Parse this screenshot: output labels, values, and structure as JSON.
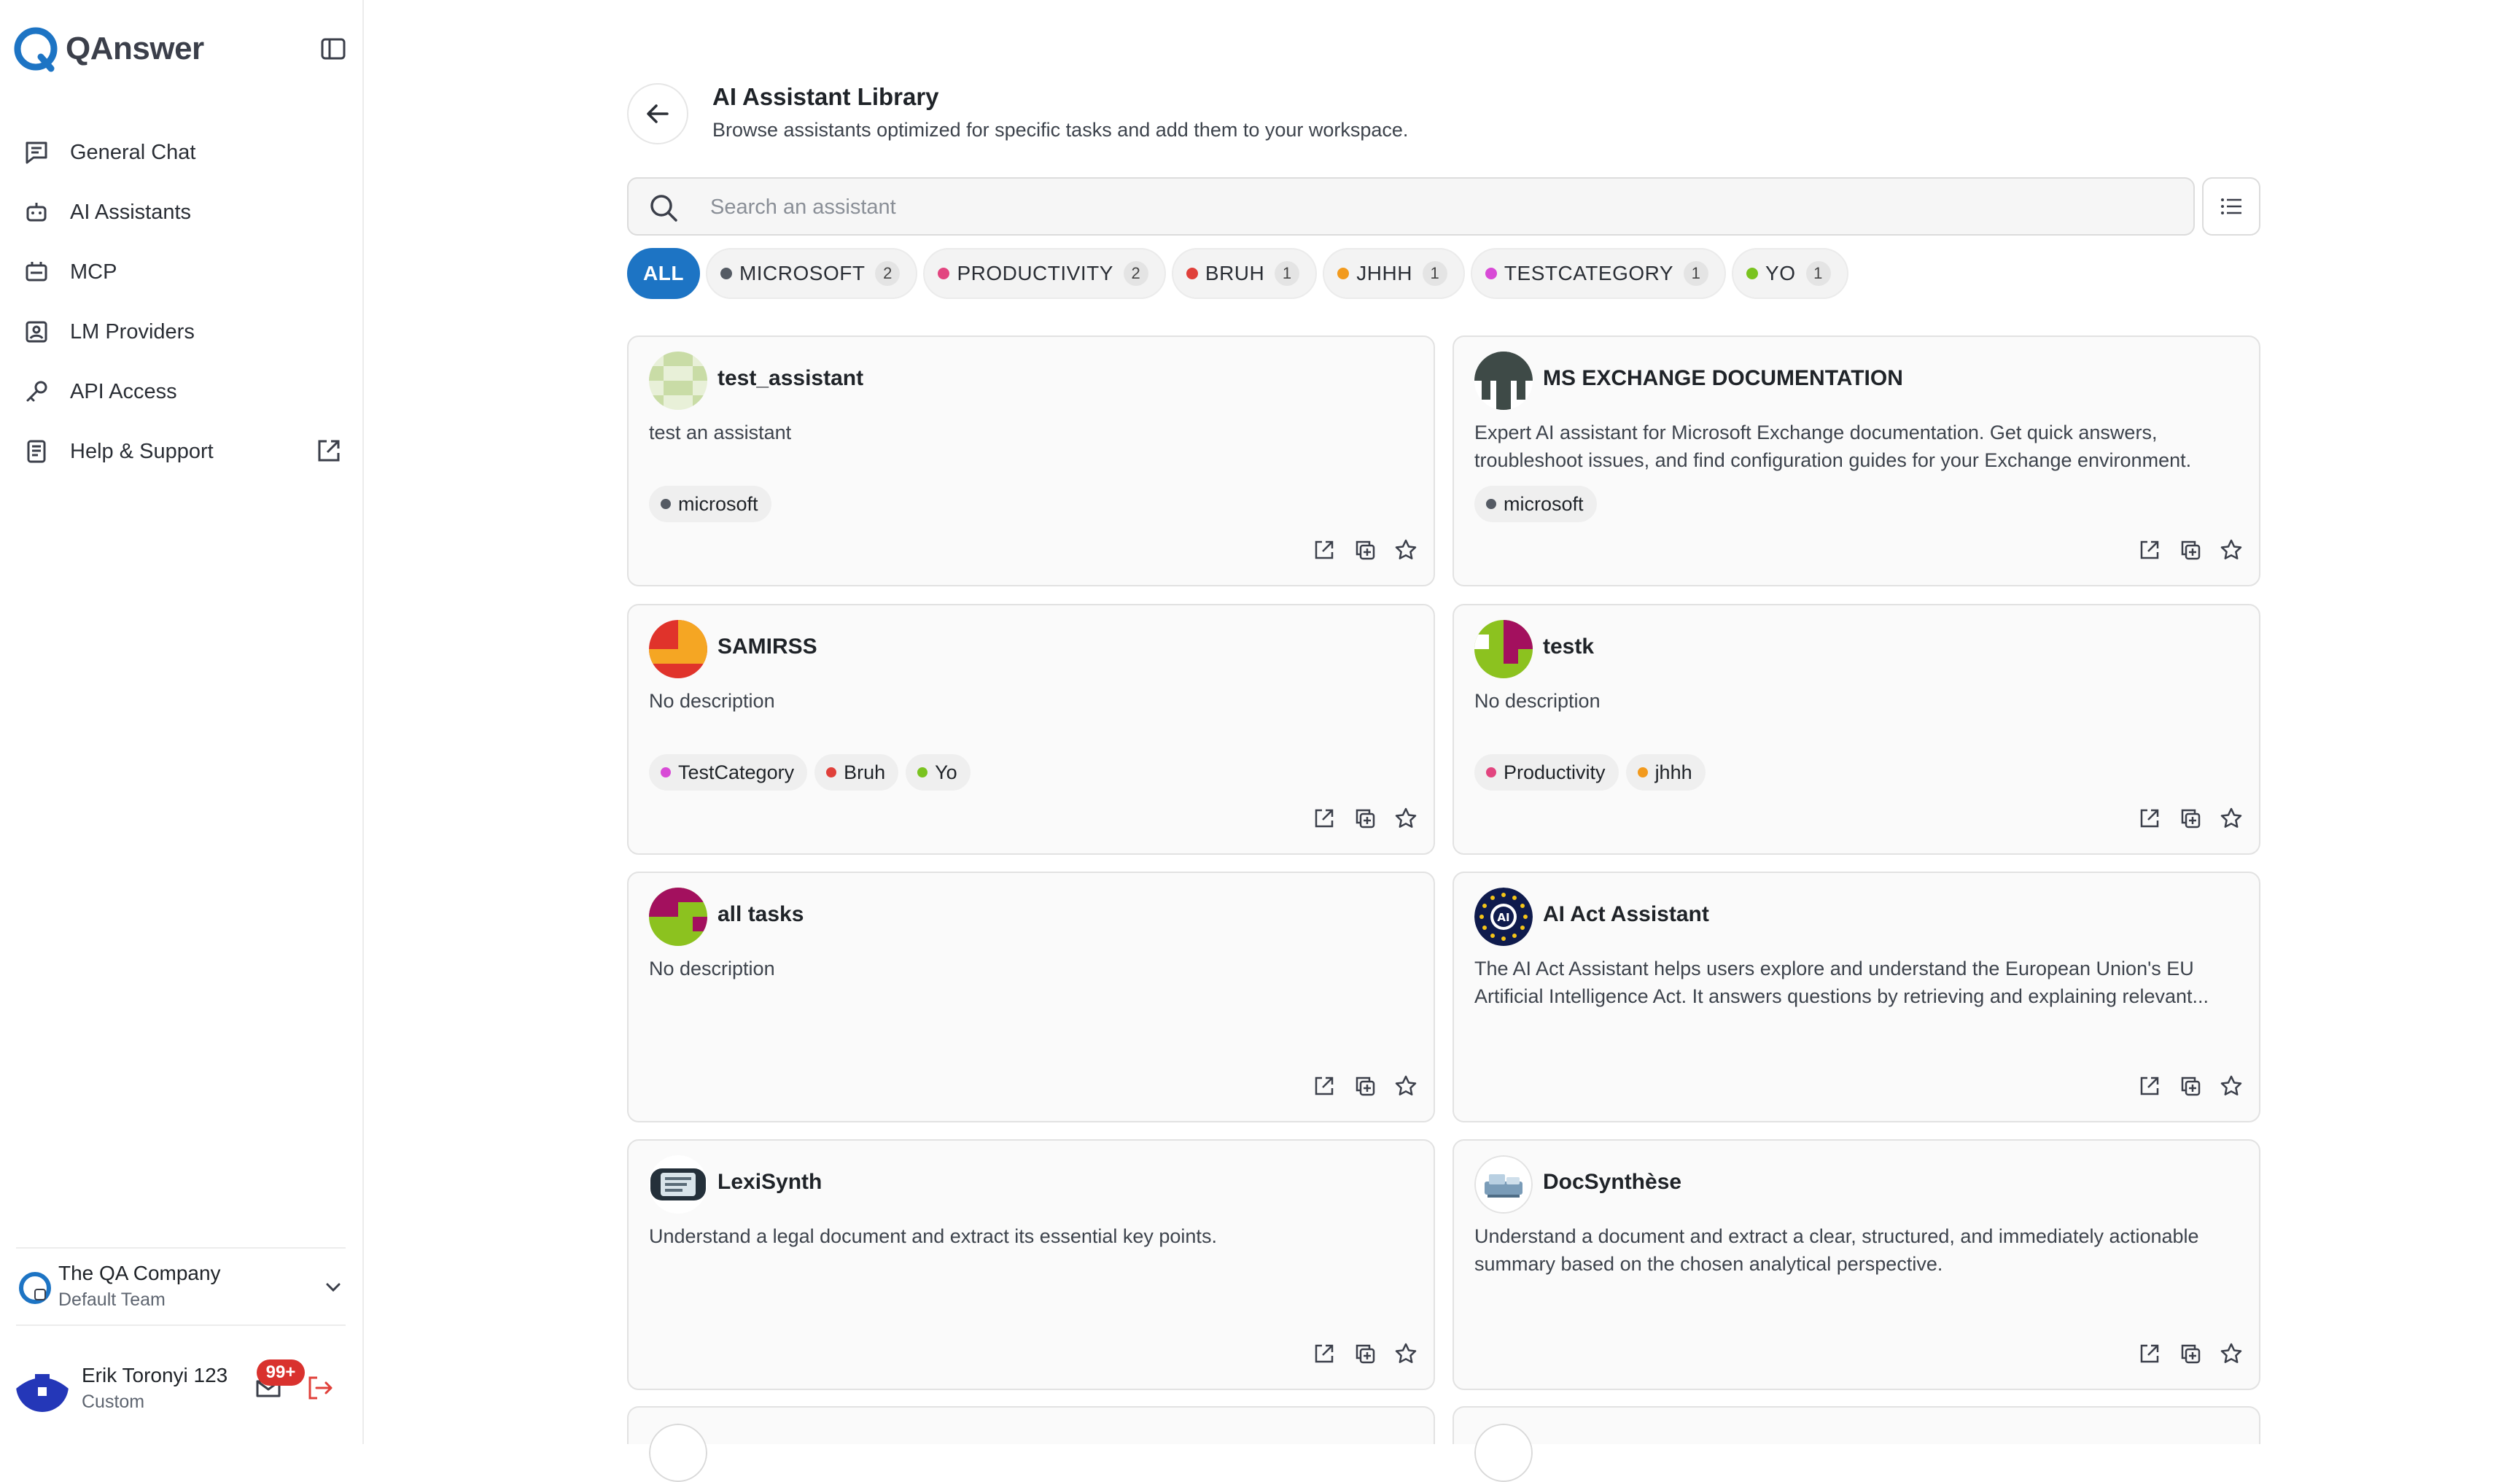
{
  "app": {
    "name": "QAnswer"
  },
  "sidebar": {
    "items": [
      {
        "label": "General Chat",
        "icon": "chat-icon"
      },
      {
        "label": "AI Assistants",
        "icon": "robot-icon"
      },
      {
        "label": "MCP",
        "icon": "mcp-icon"
      },
      {
        "label": "LM Providers",
        "icon": "provider-icon"
      },
      {
        "label": "API Access",
        "icon": "key-icon"
      },
      {
        "label": "Help & Support",
        "icon": "book-icon"
      }
    ],
    "team": {
      "name": "The QA Company",
      "sub": "Default Team"
    },
    "user": {
      "name": "Erik Toronyi 123",
      "role": "Custom",
      "badge": "99+"
    }
  },
  "header": {
    "title": "AI Assistant Library",
    "subtitle": "Browse assistants optimized for specific tasks and add them to your workspace."
  },
  "search": {
    "placeholder": "Search an assistant",
    "value": ""
  },
  "filters": [
    {
      "label": "ALL",
      "active": true
    },
    {
      "label": "MICROSOFT",
      "count": "2",
      "color": "#555b64"
    },
    {
      "label": "PRODUCTIVITY",
      "count": "2",
      "color": "#e2457f"
    },
    {
      "label": "BRUH",
      "count": "1",
      "color": "#e0403a"
    },
    {
      "label": "JHHH",
      "count": "1",
      "color": "#f29a1d"
    },
    {
      "label": "TESTCATEGORY",
      "count": "1",
      "color": "#d84ad6"
    },
    {
      "label": "YO",
      "count": "1",
      "color": "#7ac31f"
    }
  ],
  "assistants": [
    {
      "name": "test_assistant",
      "description": "test an assistant",
      "tags": [
        {
          "label": "microsoft",
          "color": "#555b64"
        }
      ]
    },
    {
      "name": "MS EXCHANGE DOCUMENTATION",
      "description": "Expert AI assistant for Microsoft Exchange documentation. Get quick answers, troubleshoot issues, and find configuration guides for your Exchange environment.",
      "tags": [
        {
          "label": "microsoft",
          "color": "#555b64"
        }
      ]
    },
    {
      "name": "SAMIRSS",
      "description": "No description",
      "tags": [
        {
          "label": "TestCategory",
          "color": "#d84ad6"
        },
        {
          "label": "Bruh",
          "color": "#e0403a"
        },
        {
          "label": "Yo",
          "color": "#7ac31f"
        }
      ]
    },
    {
      "name": "testk",
      "description": "No description",
      "tags": [
        {
          "label": "Productivity",
          "color": "#e2457f"
        },
        {
          "label": "jhhh",
          "color": "#f29a1d"
        }
      ]
    },
    {
      "name": "all tasks",
      "description": "No description",
      "tags": []
    },
    {
      "name": "AI Act Assistant",
      "description": "The AI Act Assistant helps users explore and understand the European Union's EU Artificial Intelligence Act. It answers questions by retrieving and explaining relevant...",
      "tags": []
    },
    {
      "name": "LexiSynth",
      "description": "Understand a legal document and extract its essential key points.",
      "tags": []
    },
    {
      "name": "DocSynthèse",
      "description": "Understand a document and extract a clear, structured, and immediately actionable summary based on the chosen analytical perspective.",
      "tags": []
    }
  ],
  "colors": {
    "accent": "#1d74c4",
    "badge": "#d9322e"
  }
}
